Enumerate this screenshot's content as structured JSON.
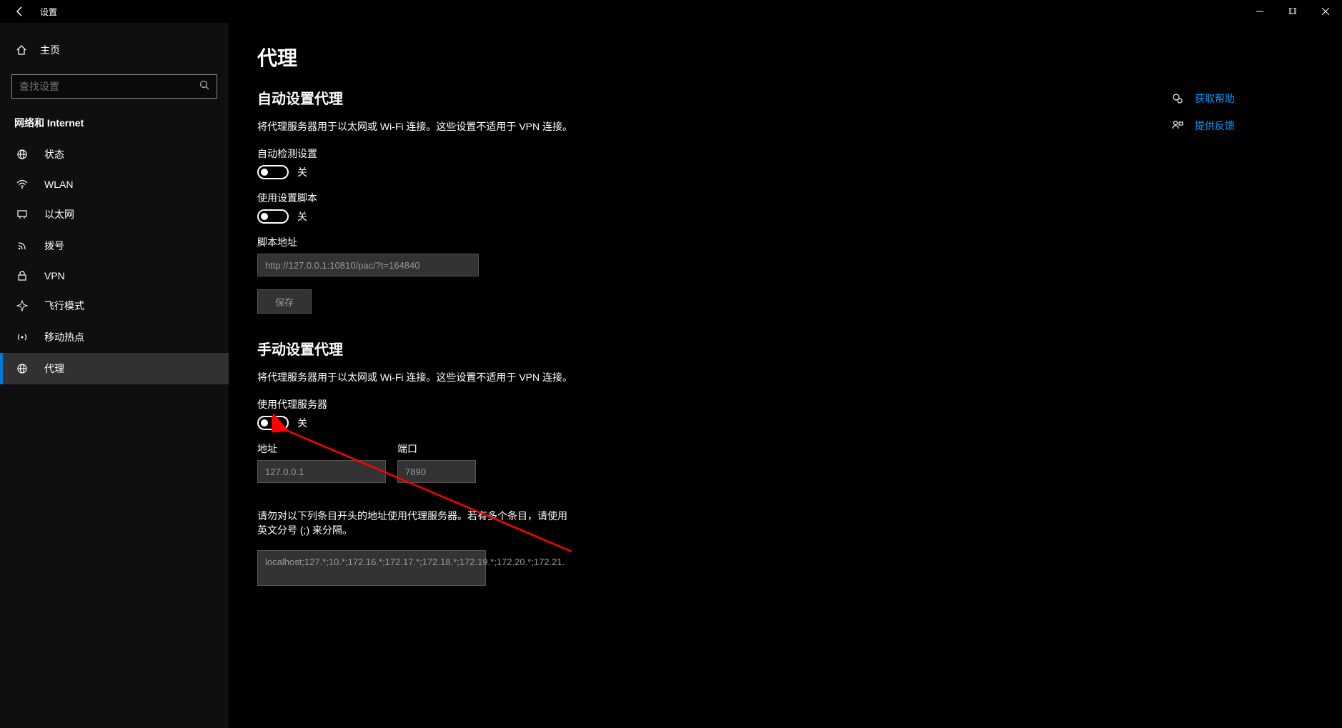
{
  "titlebar": {
    "title": "设置"
  },
  "sidebar": {
    "home": "主页",
    "search_placeholder": "查找设置",
    "category": "网络和 Internet",
    "items": [
      {
        "label": "状态"
      },
      {
        "label": "WLAN"
      },
      {
        "label": "以太网"
      },
      {
        "label": "拨号"
      },
      {
        "label": "VPN"
      },
      {
        "label": "飞行模式"
      },
      {
        "label": "移动热点"
      },
      {
        "label": "代理"
      }
    ]
  },
  "content": {
    "page_title": "代理",
    "auto": {
      "title": "自动设置代理",
      "desc": "将代理服务器用于以太网或 Wi-Fi 连接。这些设置不适用于 VPN 连接。",
      "detect_label": "自动检测设置",
      "detect_state": "关",
      "script_label": "使用设置脚本",
      "script_state": "关",
      "script_addr_label": "脚本地址",
      "script_addr_value": "http://127.0.0.1:10810/pac/?t=164840",
      "save_btn": "保存"
    },
    "manual": {
      "title": "手动设置代理",
      "desc": "将代理服务器用于以太网或 Wi-Fi 连接。这些设置不适用于 VPN 连接。",
      "use_proxy_label": "使用代理服务器",
      "use_proxy_state": "关",
      "addr_label": "地址",
      "addr_value": "127.0.0.1",
      "port_label": "端口",
      "port_value": "7890",
      "bypass_desc": "请勿对以下列条目开头的地址使用代理服务器。若有多个条目，请使用英文分号 (;) 来分隔。",
      "bypass_value": "localhost;127.*;10.*;172.16.*;172.17.*;172.18.*;172.19.*;172.20.*;172.21."
    }
  },
  "right": {
    "help": "获取帮助",
    "feedback": "提供反馈"
  }
}
